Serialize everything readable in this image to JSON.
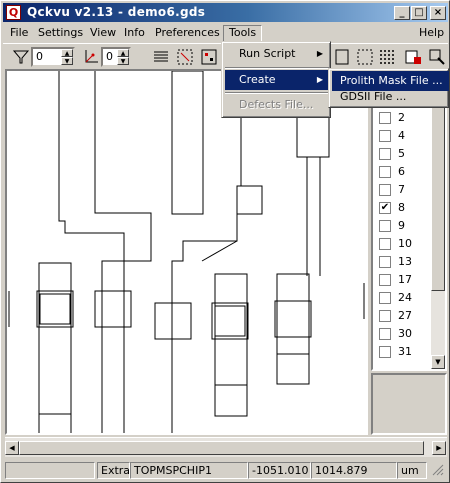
{
  "window": {
    "title": "Qckvu v2.13 - demo6.gds"
  },
  "menubar": [
    "File",
    "Settings",
    "View",
    "Info",
    "Preferences",
    "Tools",
    "Help"
  ],
  "toolbar": {
    "spin1_value": "0",
    "spin2_value": "0"
  },
  "tools_menu": {
    "items": [
      "Run Script",
      "Create",
      "Defects File..."
    ],
    "create_submenu": [
      "Prolith Mask File ...",
      "GDSII File ..."
    ]
  },
  "layers": [
    {
      "label": "2",
      "checked": false
    },
    {
      "label": "4",
      "checked": false
    },
    {
      "label": "5",
      "checked": false
    },
    {
      "label": "6",
      "checked": false
    },
    {
      "label": "7",
      "checked": false
    },
    {
      "label": "8",
      "checked": true
    },
    {
      "label": "9",
      "checked": false
    },
    {
      "label": "10",
      "checked": false
    },
    {
      "label": "13",
      "checked": false
    },
    {
      "label": "17",
      "checked": false
    },
    {
      "label": "24",
      "checked": false
    },
    {
      "label": "27",
      "checked": false
    },
    {
      "label": "30",
      "checked": false
    },
    {
      "label": "31",
      "checked": false
    }
  ],
  "status": {
    "mode": "Extra",
    "cell": "TOPMSPCHIP1",
    "x_coord": "-1051.010",
    "y_coord": "1014.879",
    "units": "um"
  },
  "colors": {
    "titlebar_start": "#0a246a",
    "titlebar_end": "#a6caf0",
    "highlight": "#0a246a"
  }
}
